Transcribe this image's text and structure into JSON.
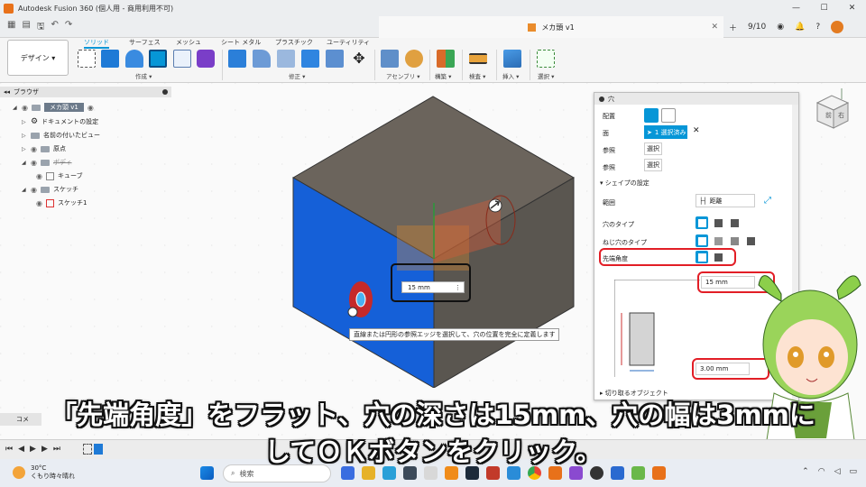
{
  "window": {
    "title": "Autodesk Fusion 360 (個人用 - 商用利用不可)",
    "controls": [
      "—",
      "☐",
      "✕"
    ]
  },
  "tabs": {
    "document_tab": "メカ頭 v1",
    "job_count": "9/10"
  },
  "ribbon": {
    "workspace": "デザイン ▾",
    "tabs": [
      "ソリッド",
      "サーフェス",
      "メッシュ",
      "シート メタル",
      "プラスチック",
      "ユーティリティ"
    ],
    "groups": [
      "作成 ▾",
      "修正 ▾",
      "アセンブリ ▾",
      "構築 ▾",
      "検査 ▾",
      "挿入 ▾",
      "選択 ▾"
    ]
  },
  "browser": {
    "title": "ブラウザ",
    "items": [
      {
        "label": "メカ頭 v1"
      },
      {
        "label": "ドキュメントの設定"
      },
      {
        "label": "名前の付いたビュー"
      },
      {
        "label": "原点"
      },
      {
        "label": "ボディ"
      },
      {
        "label": "キューブ"
      },
      {
        "label": "スケッチ"
      },
      {
        "label": "スケッチ1"
      }
    ]
  },
  "viewport": {
    "depth_input": "15 mm",
    "hint": "直線または円形の参照エッジを選択して、穴の位置を完全に定義します",
    "viewcube_labels": [
      "前",
      "右"
    ],
    "colors": {
      "blue_face": "#1560d8",
      "top_face": "#6b645c",
      "right_face": "#5a5650"
    }
  },
  "panel": {
    "title": "穴",
    "placement_label": "配置",
    "face_label": "面",
    "face_selected": "1 選択済み",
    "ref1_label": "参照",
    "ref1_value": "選択",
    "ref2_label": "参照",
    "ref2_value": "選択",
    "shape_section": "シェイプの設定",
    "extents_label": "範囲",
    "extents_value": "距離",
    "hole_type_label": "穴のタイプ",
    "thread_type_label": "ねじ穴のタイプ",
    "tip_angle_label": "先端角度",
    "depth_value": "15 mm",
    "width_value": "3.00 mm",
    "objects_to_cut": "切り取るオブジェクト",
    "accent": "#0696d7",
    "highlight": "#e21e26"
  },
  "bottom": {
    "comment_tab": "コメ",
    "playback": [
      "⏮",
      "◀",
      "▶",
      "▶",
      "⏭"
    ]
  },
  "taskbar": {
    "weather_temp": "30°C",
    "weather_desc": "くもり時々晴れ",
    "search_placeholder": "検索"
  },
  "subtitle": {
    "line1": "「先端角度」をフラット、穴の深さは15mm、穴の幅は3mmに",
    "line2": "してＯＫボタンをクリック。"
  }
}
